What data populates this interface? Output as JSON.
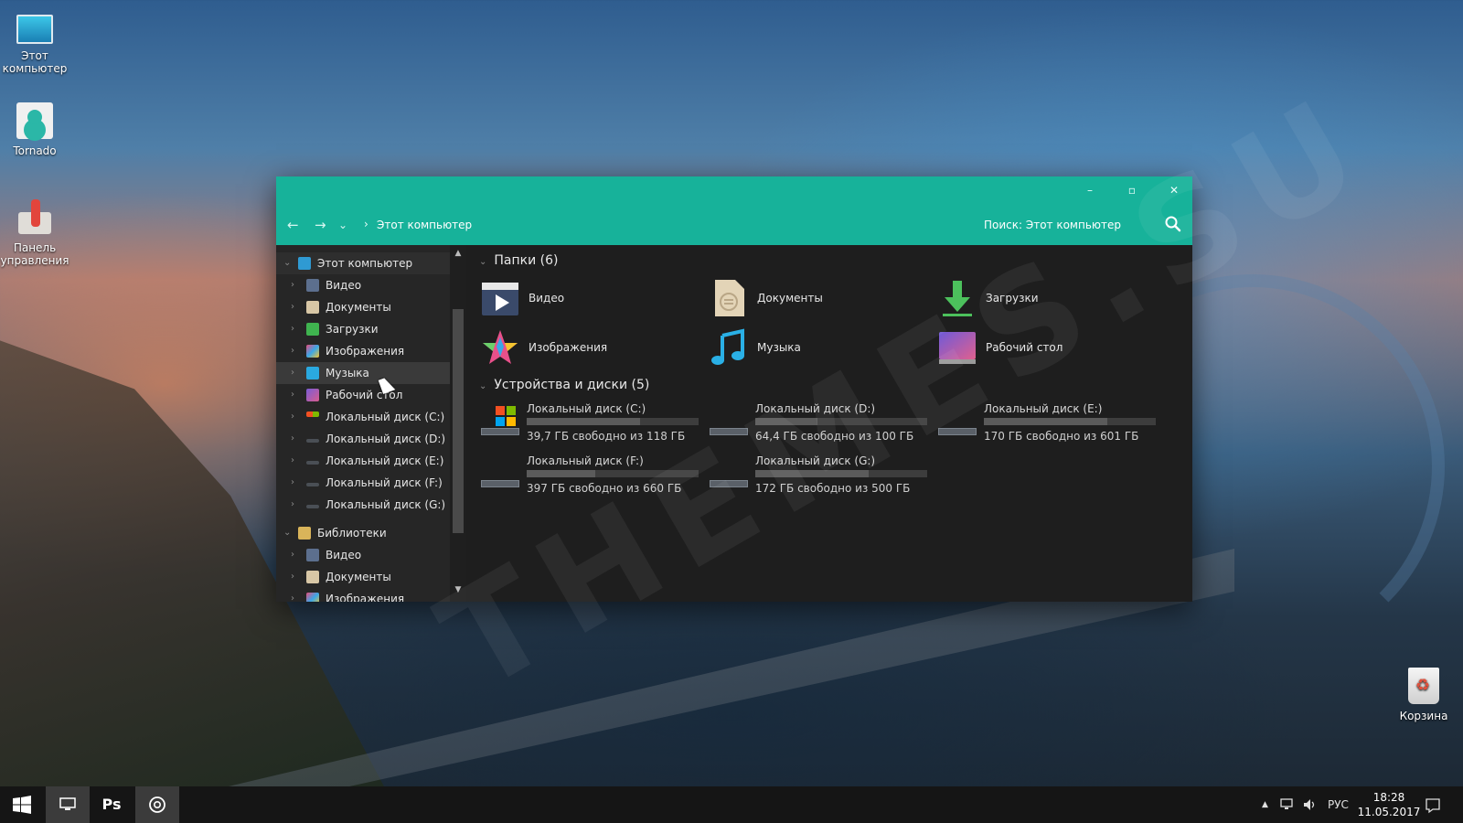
{
  "desktop": {
    "icons": [
      {
        "label": "Этот компьютер",
        "icon": "monitor-icon"
      },
      {
        "label": "Tornado",
        "icon": "user-icon"
      },
      {
        "label": "Панель управления",
        "icon": "control-panel-icon"
      },
      {
        "label": "Корзина",
        "icon": "recycle-bin-icon"
      }
    ],
    "watermark": "THEMES.SU"
  },
  "window": {
    "accent": "#17b29a",
    "controls": {
      "minimize": "–",
      "maximize": "▫",
      "close": "✕"
    },
    "nav": {
      "back": "←",
      "forward": "→",
      "recent": "⌄",
      "sep": "›"
    },
    "breadcrumb": "Этот компьютер",
    "search_placeholder": "Поиск: Этот компьютер"
  },
  "sidebar": {
    "items": [
      {
        "label": "Этот компьютер",
        "icon": "pc-icon",
        "level": 0,
        "expanded": true
      },
      {
        "label": "Видео",
        "icon": "video-icon",
        "level": 1
      },
      {
        "label": "Документы",
        "icon": "documents-icon",
        "level": 1
      },
      {
        "label": "Загрузки",
        "icon": "downloads-icon",
        "level": 1
      },
      {
        "label": "Изображения",
        "icon": "pictures-icon",
        "level": 1
      },
      {
        "label": "Музыка",
        "icon": "music-icon",
        "level": 1,
        "selected": true
      },
      {
        "label": "Рабочий стол",
        "icon": "desktop-icon",
        "level": 1
      },
      {
        "label": "Локальный диск (C:)",
        "icon": "drive-icon",
        "level": 1
      },
      {
        "label": "Локальный диск (D:)",
        "icon": "drive-icon",
        "level": 1
      },
      {
        "label": "Локальный диск (E:)",
        "icon": "drive-icon",
        "level": 1
      },
      {
        "label": "Локальный диск (F:)",
        "icon": "drive-icon",
        "level": 1
      },
      {
        "label": "Локальный диск (G:)",
        "icon": "drive-icon",
        "level": 1
      },
      {
        "label": "Библиотеки",
        "icon": "libraries-icon",
        "level": 0,
        "expanded": true
      },
      {
        "label": "Видео",
        "icon": "video-icon",
        "level": 1
      },
      {
        "label": "Документы",
        "icon": "documents-icon",
        "level": 1
      },
      {
        "label": "Изображения",
        "icon": "pictures-icon",
        "level": 1
      }
    ]
  },
  "content": {
    "folders_header": "Папки (6)",
    "folders": [
      {
        "label": "Видео",
        "icon": "video-icon"
      },
      {
        "label": "Документы",
        "icon": "documents-icon"
      },
      {
        "label": "Загрузки",
        "icon": "downloads-icon"
      },
      {
        "label": "Изображения",
        "icon": "pictures-icon"
      },
      {
        "label": "Музыка",
        "icon": "music-icon"
      },
      {
        "label": "Рабочий стол",
        "icon": "desktop-icon"
      }
    ],
    "drives_header": "Устройства и диски (5)",
    "drives": [
      {
        "name": "Локальный диск (C:)",
        "free": "39,7 ГБ свободно из 118 ГБ",
        "used_fraction": 0.66
      },
      {
        "name": "Локальный диск (D:)",
        "free": "64,4 ГБ свободно из 100 ГБ",
        "used_fraction": 0.36
      },
      {
        "name": "Локальный диск (E:)",
        "free": "170 ГБ свободно из 601 ГБ",
        "used_fraction": 0.72
      },
      {
        "name": "Локальный диск (F:)",
        "free": "397 ГБ свободно из 660 ГБ",
        "used_fraction": 0.4
      },
      {
        "name": "Локальный диск (G:)",
        "free": "172 ГБ свободно из 500 ГБ",
        "used_fraction": 0.66
      }
    ]
  },
  "taskbar": {
    "start_icon": "windows-logo-icon",
    "apps": [
      {
        "label": "",
        "icon": "explorer-icon"
      },
      {
        "label": "Ps",
        "icon": "photoshop-icon"
      },
      {
        "label": "",
        "icon": "chrome-icon"
      }
    ],
    "tray": {
      "chevron": "▲",
      "language": "РУС"
    },
    "time": "18:28",
    "date": "11.05.2017"
  }
}
